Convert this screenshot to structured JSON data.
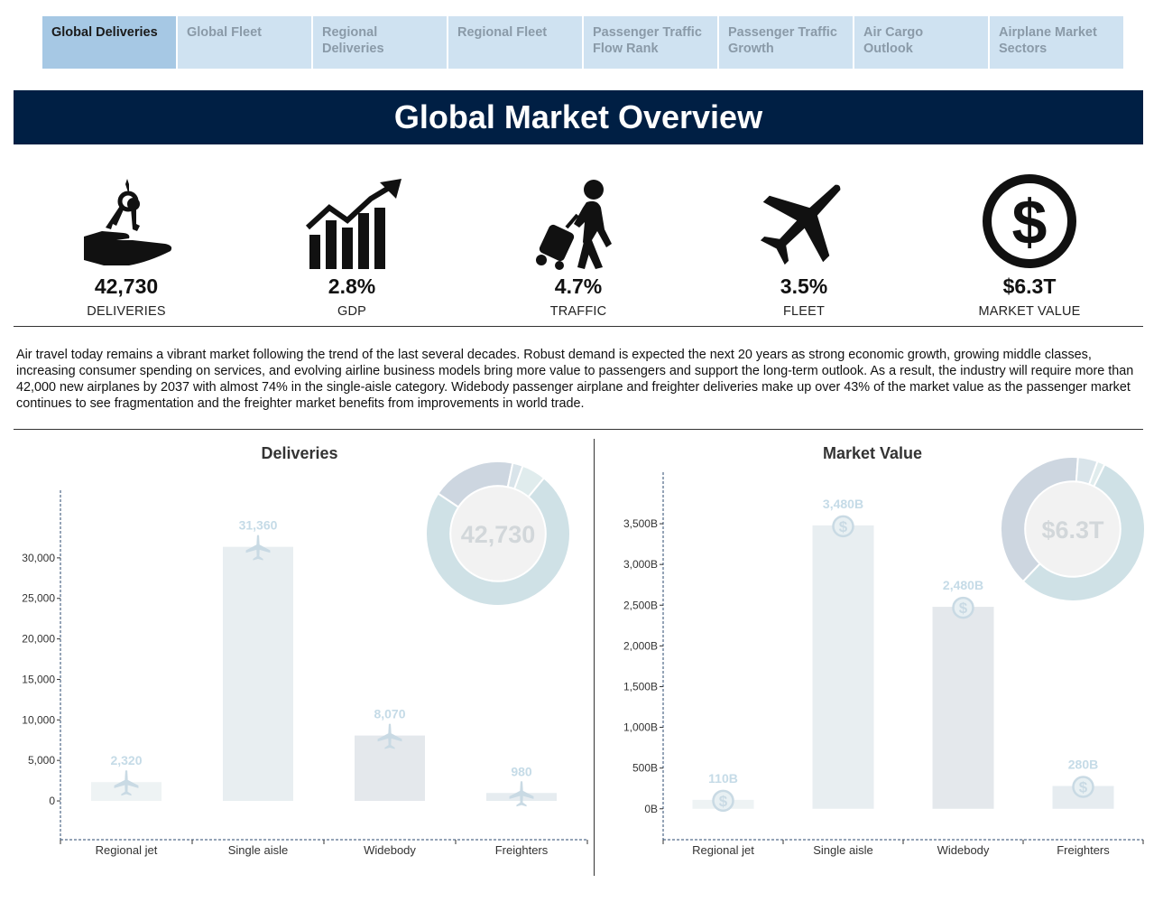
{
  "tabs": [
    {
      "label_1": "Global Deliveries",
      "label_2": "",
      "active": true
    },
    {
      "label_1": "Global Fleet",
      "label_2": "",
      "active": false
    },
    {
      "label_1": "Regional",
      "label_2": "Deliveries",
      "active": false
    },
    {
      "label_1": "Regional Fleet",
      "label_2": "",
      "active": false
    },
    {
      "label_1": "Passenger Traffic",
      "label_2": "Flow Rank",
      "active": false
    },
    {
      "label_1": "Passenger Traffic",
      "label_2": "Growth",
      "active": false
    },
    {
      "label_1": "Air Cargo",
      "label_2": "Outlook",
      "active": false
    },
    {
      "label_1": "Airplane Market",
      "label_2": "Sectors",
      "active": false
    }
  ],
  "banner": {
    "title": "Global Market Overview"
  },
  "kpis": [
    {
      "value": "42,730",
      "label": "DELIVERIES",
      "icon": "hand-keys-icon"
    },
    {
      "value": "2.8%",
      "label": "GDP",
      "icon": "growth-chart-icon"
    },
    {
      "value": "4.7%",
      "label": "TRAFFIC",
      "icon": "traveler-icon"
    },
    {
      "value": "3.5%",
      "label": "FLEET",
      "icon": "airplane-icon"
    },
    {
      "value": "$6.3T",
      "label": "MARKET VALUE",
      "icon": "dollar-icon"
    }
  ],
  "description": "Air travel today remains a vibrant market following the trend of the last several decades. Robust demand is expected the next 20 years as strong economic growth, growing middle classes, increasing consumer spending on services, and evolving airline business models bring more value to passengers and support the long-term outlook.  As a result, the industry will require more than 42,000 new airplanes by 2037 with almost 74% in the single-aisle category. Widebody passenger airplane and freighter deliveries make up over 43% of the market value as the passenger market continues to see fragmentation and the freighter market benefits from improvements in world trade.",
  "colors": {
    "banner": "#001f44",
    "tab": "#cfe2f1",
    "tab_active": "#a6c8e4",
    "bar_label": "#c5dbe7"
  },
  "chart_data": [
    {
      "type": "bar",
      "title": "Deliveries",
      "categories": [
        "Regional jet",
        "Single aisle",
        "Widebody",
        "Freighters"
      ],
      "values": [
        2320,
        31360,
        8070,
        980
      ],
      "value_labels": [
        "2,320",
        "31,360",
        "8,070",
        "980"
      ],
      "yticks": [
        0,
        5000,
        10000,
        15000,
        20000,
        25000,
        30000
      ],
      "ytick_labels": [
        "0",
        "5,000",
        "10,000",
        "15,000",
        "20,000",
        "25,000",
        "30,000"
      ],
      "ylim": [
        -2000,
        35000
      ],
      "bar_colors": [
        "#eef3f4",
        "#e8eef1",
        "#e4e8ec",
        "#e6ecf0"
      ],
      "mark_icon": "airplane-icon",
      "donut": {
        "center_label": "42,730",
        "values": [
          2320,
          31360,
          8070,
          980
        ],
        "colors": [
          "#e0eced",
          "#cfe1e6",
          "#cdd6e0",
          "#d9e4ea"
        ]
      }
    },
    {
      "type": "bar",
      "title": "Market Value",
      "categories": [
        "Regional jet",
        "Single aisle",
        "Widebody",
        "Freighters"
      ],
      "values": [
        110,
        3480,
        2480,
        280
      ],
      "value_labels": [
        "110B",
        "3,480B",
        "2,480B",
        "280B"
      ],
      "yticks": [
        0,
        500,
        1000,
        1500,
        2000,
        2500,
        3000,
        3500
      ],
      "ytick_labels": [
        "0B",
        "500B",
        "1,000B",
        "1,500B",
        "2,000B",
        "2,500B",
        "3,000B",
        "3,500B"
      ],
      "ylim": [
        -180,
        3800
      ],
      "bar_colors": [
        "#eef3f4",
        "#e8eef1",
        "#e4e8ec",
        "#e6ecf0"
      ],
      "mark_icon": "dollar-icon",
      "donut": {
        "center_label": "$6.3T",
        "values": [
          110,
          3480,
          2480,
          280
        ],
        "colors": [
          "#e0eced",
          "#cfe1e6",
          "#cdd6e0",
          "#d9e4ea"
        ]
      }
    }
  ]
}
